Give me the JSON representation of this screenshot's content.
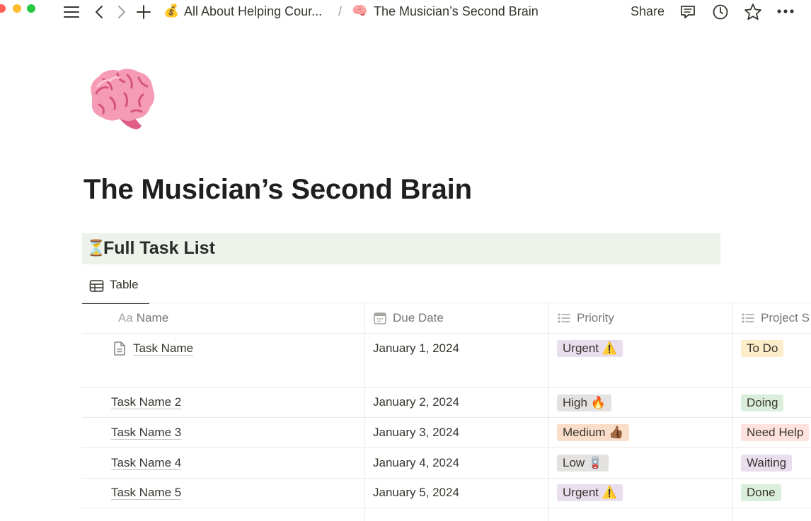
{
  "topbar": {
    "breadcrumb_parent_emoji": "💰",
    "breadcrumb_parent": "All About Helping Cour...",
    "breadcrumb_separator": "/",
    "breadcrumb_current_emoji": "🧠",
    "breadcrumb_current": "The Musician’s Second Brain",
    "share_label": "Share",
    "icons": [
      "menu-icon",
      "back-icon",
      "forward-icon",
      "new-page-icon",
      "comments-icon",
      "history-icon",
      "favorite-icon",
      "more-icon"
    ]
  },
  "page": {
    "icon_name": "brain-icon",
    "title": "The Musician’s Second Brain"
  },
  "callout": {
    "emoji": "⏳",
    "text": "Full Task List",
    "background": "#edf2ea"
  },
  "views": {
    "tab_label": "Table"
  },
  "table": {
    "columns": [
      {
        "label": "Name",
        "icon": "title-icon"
      },
      {
        "label": "Due Date",
        "icon": "calendar-icon"
      },
      {
        "label": "Priority",
        "icon": "list-icon"
      },
      {
        "label": "Project S",
        "icon": "list-icon"
      }
    ],
    "rows": [
      {
        "name": "Task Name",
        "due": "January 1, 2024",
        "priority": "Urgent ⚠️",
        "status": "To Do"
      },
      {
        "name": "Task Name 2",
        "due": "January 2, 2024",
        "priority": "High 🔥",
        "status": "Doing"
      },
      {
        "name": "Task Name 3",
        "due": "January 3, 2024",
        "priority": "Medium 👍🏾",
        "status": "Need Help"
      },
      {
        "name": "Task Name 4",
        "due": "January 4, 2024",
        "priority": "Low 🪫",
        "status": "Waiting"
      },
      {
        "name": "Task Name 5",
        "due": "January 5, 2024",
        "priority": "Urgent ⚠️",
        "status": "Done"
      }
    ]
  },
  "colors": {
    "tag_purple": "#e8deee",
    "tag_gray": "#e3e2e0",
    "tag_orange": "#fadec9",
    "tag_yellow": "#fdecc8",
    "tag_green": "#dbeddb",
    "tag_red": "#ffe2dd",
    "text": "#37352f"
  }
}
